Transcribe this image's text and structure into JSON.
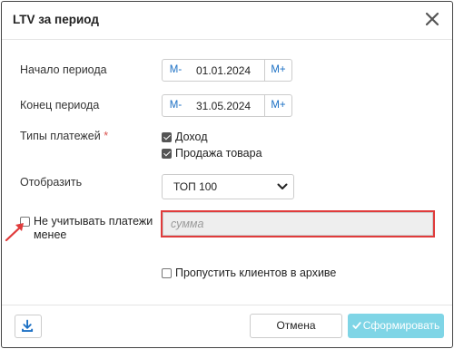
{
  "dialog": {
    "title": "LTV за период",
    "close_icon": "close-icon"
  },
  "form": {
    "start": {
      "label": "Начало периода",
      "minus": "M-",
      "value": "01.01.2024",
      "plus": "M+"
    },
    "end": {
      "label": "Конец периода",
      "minus": "M-",
      "value": "31.05.2024",
      "plus": "M+"
    },
    "payment_types": {
      "label": "Типы платежей",
      "required_mark": "*",
      "options": [
        {
          "label": "Доход",
          "checked": true
        },
        {
          "label": "Продажа товара",
          "checked": true
        }
      ]
    },
    "display": {
      "label": "Отобразить",
      "selected": "ТОП 100"
    },
    "ignore": {
      "label": "Не учитывать платежи менее",
      "checked": false,
      "placeholder": "сумма",
      "value": ""
    },
    "skip_archived": {
      "label": "Пропустить клиентов в архиве",
      "checked": false
    }
  },
  "footer": {
    "download_icon": "download-icon",
    "cancel_label": "Отмена",
    "submit_label": "Сформировать",
    "submit_icon": "check-icon",
    "submit_color": "#7fd5e6"
  },
  "annotation": {
    "color": "#e03b3b"
  }
}
